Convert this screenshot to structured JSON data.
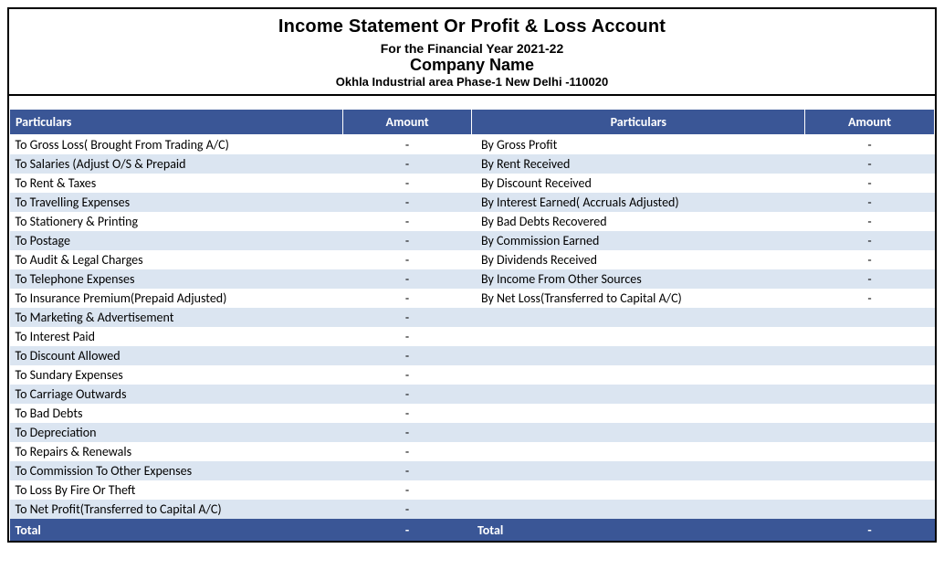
{
  "header": {
    "title": "Income Statement Or Profit & Loss Account",
    "subtitle": "For the Financial Year 2021-22",
    "company": "Company Name",
    "address": "Okhla Industrial area Phase-1 New Delhi -110020"
  },
  "columns": {
    "left_particulars": "Particulars",
    "left_amount": "Amount",
    "right_particulars": "Particulars",
    "right_amount": "Amount"
  },
  "debit": [
    {
      "label": "To Gross Loss( Brought From Trading A/C)",
      "amount": "-"
    },
    {
      "label": "To Salaries (Adjust O/S & Prepaid",
      "amount": "-"
    },
    {
      "label": "To Rent & Taxes",
      "amount": "-"
    },
    {
      "label": "To Travelling Expenses",
      "amount": "-"
    },
    {
      "label": "To Stationery & Printing",
      "amount": "-"
    },
    {
      "label": "To Postage",
      "amount": "-"
    },
    {
      "label": "To Audit & Legal Charges",
      "amount": "-"
    },
    {
      "label": "To Telephone Expenses",
      "amount": "-"
    },
    {
      "label": "To Insurance Premium(Prepaid Adjusted)",
      "amount": "-"
    },
    {
      "label": "To Marketing & Advertisement",
      "amount": "-"
    },
    {
      "label": "To Interest Paid",
      "amount": "-"
    },
    {
      "label": "To Discount Allowed",
      "amount": "-"
    },
    {
      "label": "To Sundary Expenses",
      "amount": "-"
    },
    {
      "label": "To Carriage Outwards",
      "amount": "-"
    },
    {
      "label": "To Bad Debts",
      "amount": "-"
    },
    {
      "label": "To Depreciation",
      "amount": "-"
    },
    {
      "label": "To Repairs & Renewals",
      "amount": "-"
    },
    {
      "label": "To Commission To Other Expenses",
      "amount": "-"
    },
    {
      "label": "To Loss By Fire Or Theft",
      "amount": "-"
    },
    {
      "label": "To Net Profit(Transferred to Capital A/C)",
      "amount": "-"
    }
  ],
  "credit": [
    {
      "label": "By Gross Profit",
      "amount": "-"
    },
    {
      "label": "By Rent Received",
      "amount": "-"
    },
    {
      "label": "By Discount Received",
      "amount": "-"
    },
    {
      "label": "By Interest Earned( Accruals Adjusted)",
      "amount": "-"
    },
    {
      "label": "By Bad Debts Recovered",
      "amount": "-"
    },
    {
      "label": "By Commission Earned",
      "amount": "-"
    },
    {
      "label": "By Dividends Received",
      "amount": "-"
    },
    {
      "label": "By Income From Other Sources",
      "amount": "-"
    },
    {
      "label": "By Net Loss(Transferred to Capital A/C)",
      "amount": "-"
    }
  ],
  "totals": {
    "left_label": "Total",
    "left_value": "-",
    "right_label": "Total",
    "right_value": "-"
  }
}
